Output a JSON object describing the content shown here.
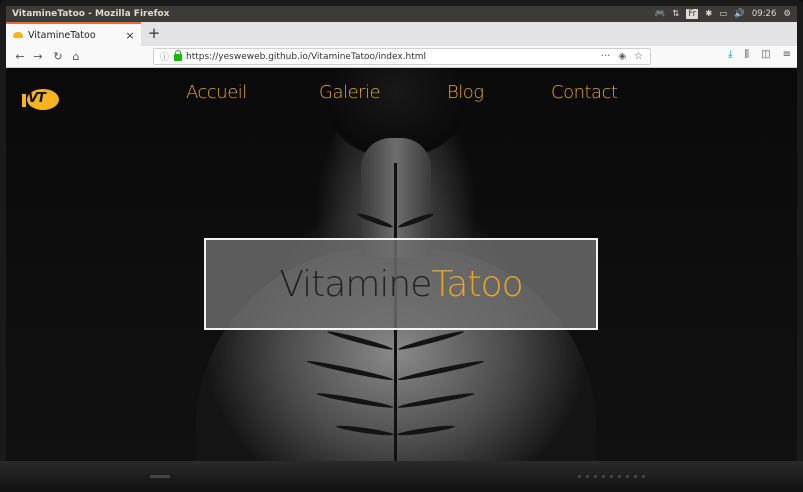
{
  "window": {
    "title": "VitamineTatoo - Mozilla Firefox"
  },
  "tray": {
    "lang": "Fr",
    "clock": "09:26"
  },
  "tab": {
    "label": "VitamineTatoo",
    "close": "×",
    "new_tab": "+"
  },
  "toolbar": {
    "url": "https://yesweweb.github.io/VitamineTatoo/index.html",
    "more": "···"
  },
  "site": {
    "logo_text": "VT",
    "nav": [
      "Accueil",
      "Galerie",
      "Blog",
      "Contact"
    ],
    "hero_word1": "Vitamine",
    "hero_word2": "Tatoo"
  },
  "colors": {
    "accent": "#e8a425",
    "os_bar": "#3c3b37",
    "tab_accent": "#ef6a31"
  }
}
